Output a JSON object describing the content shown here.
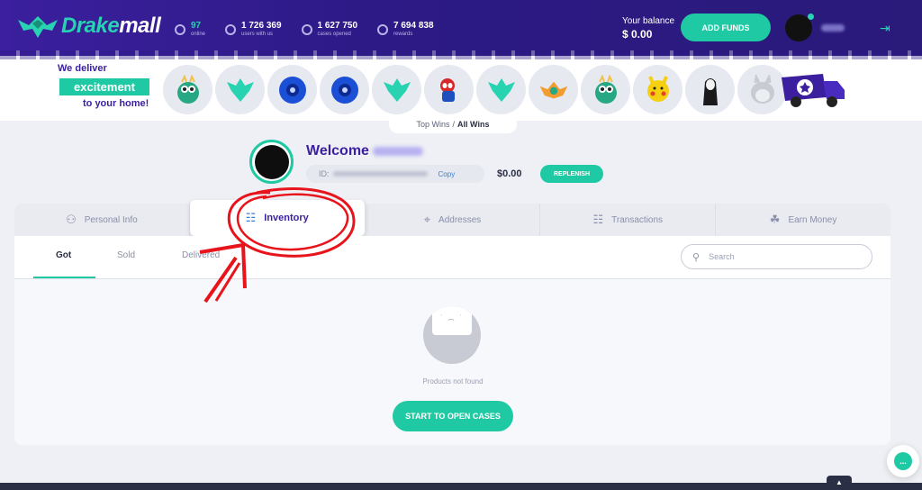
{
  "header": {
    "logo_text_a": "Drake",
    "logo_text_b": "mall",
    "stats": [
      {
        "value": "97",
        "label": "online",
        "icon": "user-icon"
      },
      {
        "value": "1 726 369",
        "label": "users with us",
        "icon": "users-icon"
      },
      {
        "value": "1 627 750",
        "label": "cases opened",
        "icon": "case-icon"
      },
      {
        "value": "7 694 838",
        "label": "rewards",
        "icon": "dollar-icon"
      }
    ],
    "balance_label": "Your balance",
    "balance_value": "$ 0.00",
    "add_funds_label": "ADD FUNDS"
  },
  "ticker": {
    "promo_line1": "We deliver",
    "promo_line2": "excitement",
    "promo_line3": "to your home!",
    "tab_top": "Top Wins",
    "tab_sep": "/",
    "tab_all": "All Wins",
    "items": [
      "dragon-figure",
      "drakemall-box",
      "blue-yoyo",
      "blue-yoyo",
      "drakemall-box",
      "spiderman-figure",
      "drakemall-box",
      "drakemall-logo",
      "dragon-figure",
      "pikachu-figure",
      "no-face-figure",
      "totoro-plush"
    ]
  },
  "profile": {
    "welcome": "Welcome",
    "id_prefix": "ID:",
    "copy_label": "Copy",
    "balance": "$0.00",
    "replenish_label": "REPLENISH"
  },
  "tabs": [
    {
      "label": "Personal Info",
      "icon": "user-icon"
    },
    {
      "label": "Inventory",
      "icon": "inventory-icon"
    },
    {
      "label": "Addresses",
      "icon": "map-pin-icon"
    },
    {
      "label": "Transactions",
      "icon": "transactions-icon"
    },
    {
      "label": "Earn Money",
      "icon": "handshake-icon"
    }
  ],
  "subtabs": [
    "Got",
    "Sold",
    "Delivered"
  ],
  "search": {
    "placeholder": "Search"
  },
  "empty": {
    "message": "Products not found",
    "cta": "START TO OPEN CASES"
  },
  "colors": {
    "brand": "#3b1f9e",
    "accent": "#1fc9a3",
    "annotation": "#e8141b"
  }
}
